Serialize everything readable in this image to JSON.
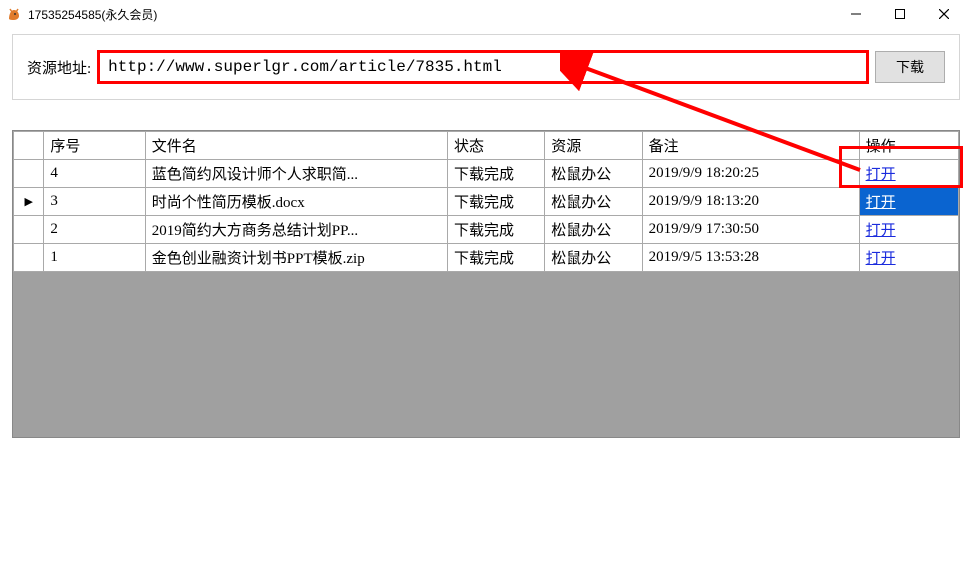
{
  "window": {
    "title": "17535254585(永久会员)"
  },
  "toolbar": {
    "address_label": "资源地址:",
    "url_value": "http://www.superlgr.com/article/7835.html",
    "download_label": "下载"
  },
  "grid": {
    "headers": {
      "seq": "序号",
      "filename": "文件名",
      "status": "状态",
      "resource": "资源",
      "note": "备注",
      "action": "操作"
    },
    "rows": [
      {
        "mark": "",
        "seq": "4",
        "filename": "蓝色简约风设计师个人求职简...",
        "status": "下载完成",
        "resource": "松鼠办公",
        "note": "2019/9/9 18:20:25",
        "action": "打开",
        "selected": false,
        "hl_action": true
      },
      {
        "mark": "▶",
        "seq": "3",
        "filename": "时尚个性简历模板.docx",
        "status": "下载完成",
        "resource": "松鼠办公",
        "note": "2019/9/9 18:13:20",
        "action": "打开",
        "selected": true
      },
      {
        "mark": "",
        "seq": "2",
        "filename": "2019简约大方商务总结计划PP...",
        "status": "下载完成",
        "resource": "松鼠办公",
        "note": "2019/9/9 17:30:50",
        "action": "打开",
        "selected": false
      },
      {
        "mark": "",
        "seq": "1",
        "filename": "金色创业融资计划书PPT模板.zip",
        "status": "下载完成",
        "resource": "松鼠办公",
        "note": "2019/9/5 13:53:28",
        "action": "打开",
        "selected": false
      }
    ]
  }
}
